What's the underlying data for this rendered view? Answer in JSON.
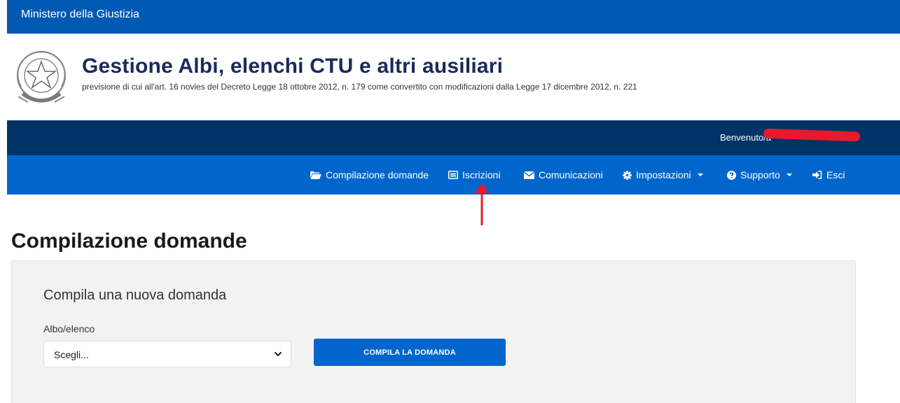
{
  "topbar": {
    "ministry": "Ministero della Giustizia"
  },
  "header": {
    "title": "Gestione Albi, elenchi CTU e altri ausiliari",
    "subtitle": "previsione di cui all'art. 16 novies del Decreto Legge 18 ottobre 2012, n. 179 come convertito con modificazioni dalla Legge 17 dicembre 2012, n. 221"
  },
  "userbar": {
    "welcome": "Benvenuto/a"
  },
  "nav": {
    "items": [
      {
        "label": "Compilazione domande",
        "icon": "folder-open-icon"
      },
      {
        "label": "Iscrizioni",
        "icon": "list-alt-icon"
      },
      {
        "label": "Comunicazioni",
        "icon": "envelope-icon"
      },
      {
        "label": "Impostazioni",
        "icon": "cog-icon",
        "dropdown": true
      },
      {
        "label": "Supporto",
        "icon": "question-circle-icon",
        "dropdown": true
      },
      {
        "label": "Esci",
        "icon": "sign-out-icon"
      }
    ]
  },
  "main": {
    "page_title": "Compilazione domande",
    "panel": {
      "title": "Compila una nuova domanda",
      "field_label": "Albo/elenco",
      "select_value": "Scegli...",
      "button_label": "COMPILA LA DOMANDA"
    }
  },
  "colors": {
    "topbar": "#0059b3",
    "userbar": "#003366",
    "navbar": "#0066cc",
    "button": "#0066cc",
    "annotation_arrow": "#e8192c"
  }
}
